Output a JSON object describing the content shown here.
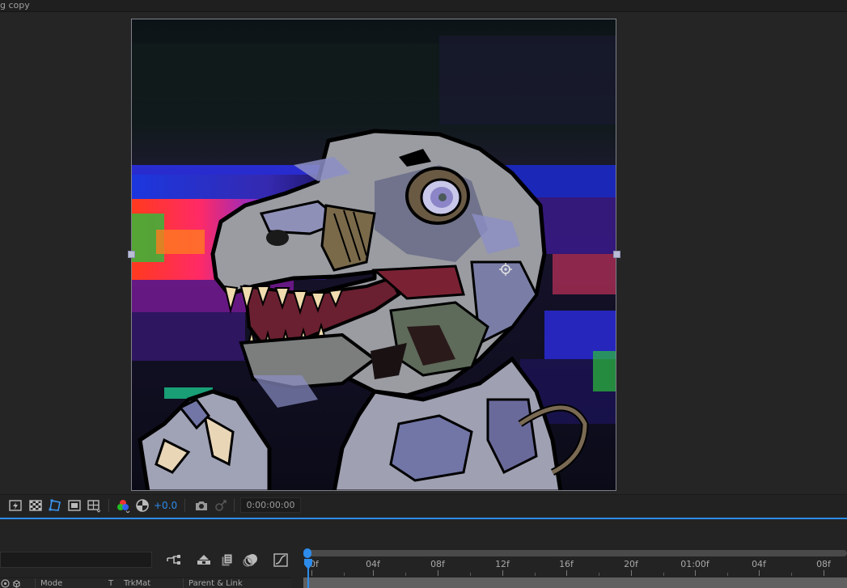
{
  "window": {
    "tab_label": "g copy"
  },
  "viewer": {
    "toolbar": {
      "exposure": "+0.0",
      "timecode": "0:00:00:00",
      "icons": [
        "fast-previews-icon",
        "transparency-grid-icon",
        "mask-visibility-icon",
        "region-of-interest-icon",
        "guides-icon",
        "channels-icon",
        "reset-exposure-icon",
        "snapshot-icon",
        "show-snapshot-icon"
      ]
    }
  },
  "timeline": {
    "search_placeholder": "",
    "icons": [
      "composition-flowchart-icon",
      "draft-3d-icon",
      "frame-blending-icon",
      "motion-blur-icon",
      "graph-editor-icon"
    ],
    "columns": {
      "mode": "Mode",
      "t": "T",
      "trkmat": "TrkMat",
      "parent": "Parent & Link"
    },
    "ruler": [
      "00f",
      "04f",
      "08f",
      "12f",
      "16f",
      "20f",
      "01:00f",
      "04f",
      "08f"
    ]
  },
  "colors": {
    "accent": "#2d8ceb",
    "panel_bg": "#232323"
  }
}
